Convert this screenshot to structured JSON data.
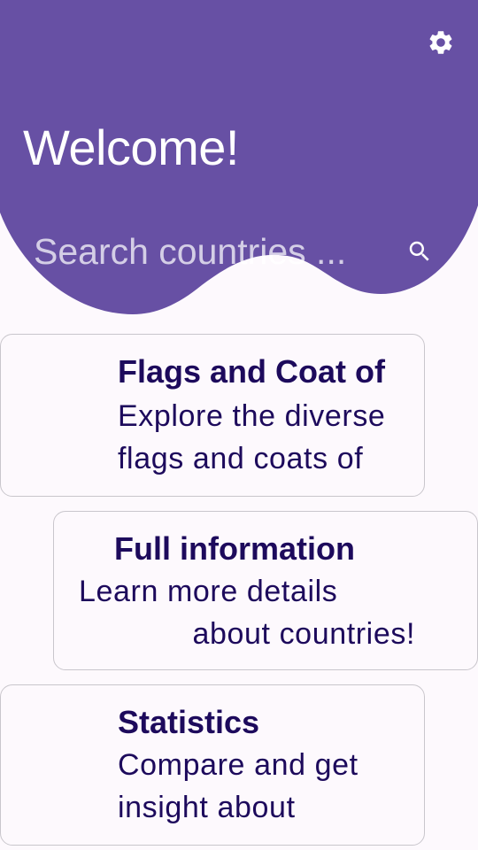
{
  "header": {
    "title": "Welcome!",
    "background_color": "#6750a4",
    "settings_icon": "gear-icon"
  },
  "search": {
    "placeholder": "Search countries ...",
    "value": "",
    "icon": "search-icon"
  },
  "cards": [
    {
      "title": "Flags and Coat of",
      "description_lines": [
        "Explore the diverse",
        "flags and coats of"
      ]
    },
    {
      "title": "Full information",
      "description_lines": [
        "Learn more details",
        "about countries!"
      ]
    },
    {
      "title": "Statistics",
      "description_lines": [
        "Compare and get",
        "insight about"
      ]
    }
  ],
  "colors": {
    "accent": "#6750a4",
    "card_text": "#1d0a5c",
    "card_border": "#c9c6cc",
    "background": "#fdf9fd"
  }
}
